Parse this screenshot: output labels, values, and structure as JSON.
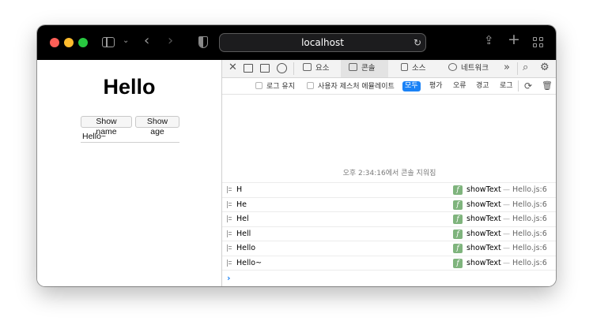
{
  "browser": {
    "url": "localhost",
    "reload_icon": "↻",
    "back_icon": "‹",
    "forward_icon": "›",
    "chevron_icon": "⌄",
    "share_icon": "⇪",
    "new_tab_icon": "+"
  },
  "page": {
    "title": "Hello",
    "show_name_label": "Show name",
    "show_age_label": "Show age",
    "input_value": "Hello~"
  },
  "devtools": {
    "tabs": [
      {
        "label": "요소"
      },
      {
        "label": "콘솔"
      },
      {
        "label": "소스"
      },
      {
        "label": "네트워크"
      }
    ],
    "more_icon": "»",
    "close_icon": "✕",
    "search_icon": "⌕",
    "settings_icon": "⚙",
    "filters": {
      "preserve_log": "로그 유지",
      "user_gesture_emulation": "사용자 제스처 에뮬레이트",
      "levels": [
        "모두",
        "평가",
        "오류",
        "경고",
        "로그"
      ]
    },
    "cleared_message": "오후 2:34:16에서 콘솔 지워짐",
    "logs": [
      {
        "message": "H",
        "badge": "f",
        "function": "showText",
        "separator": "—",
        "source": "Hello.js:6"
      },
      {
        "message": "He",
        "badge": "f",
        "function": "showText",
        "separator": "—",
        "source": "Hello.js:6"
      },
      {
        "message": "Hel",
        "badge": "f",
        "function": "showText",
        "separator": "—",
        "source": "Hello.js:6"
      },
      {
        "message": "Hell",
        "badge": "f",
        "function": "showText",
        "separator": "—",
        "source": "Hello.js:6"
      },
      {
        "message": "Hello",
        "badge": "f",
        "function": "showText",
        "separator": "—",
        "source": "Hello.js:6"
      },
      {
        "message": "Hello~",
        "badge": "f",
        "function": "showText",
        "separator": "—",
        "source": "Hello.js:6"
      }
    ],
    "prompt_icon": "›"
  },
  "colors": {
    "accent": "#1a82f6",
    "titlebar": "#000000",
    "traffic_red": "#fe5f57",
    "traffic_yellow": "#febc2e",
    "traffic_green": "#28c840",
    "function_badge": "#7fb47d"
  }
}
